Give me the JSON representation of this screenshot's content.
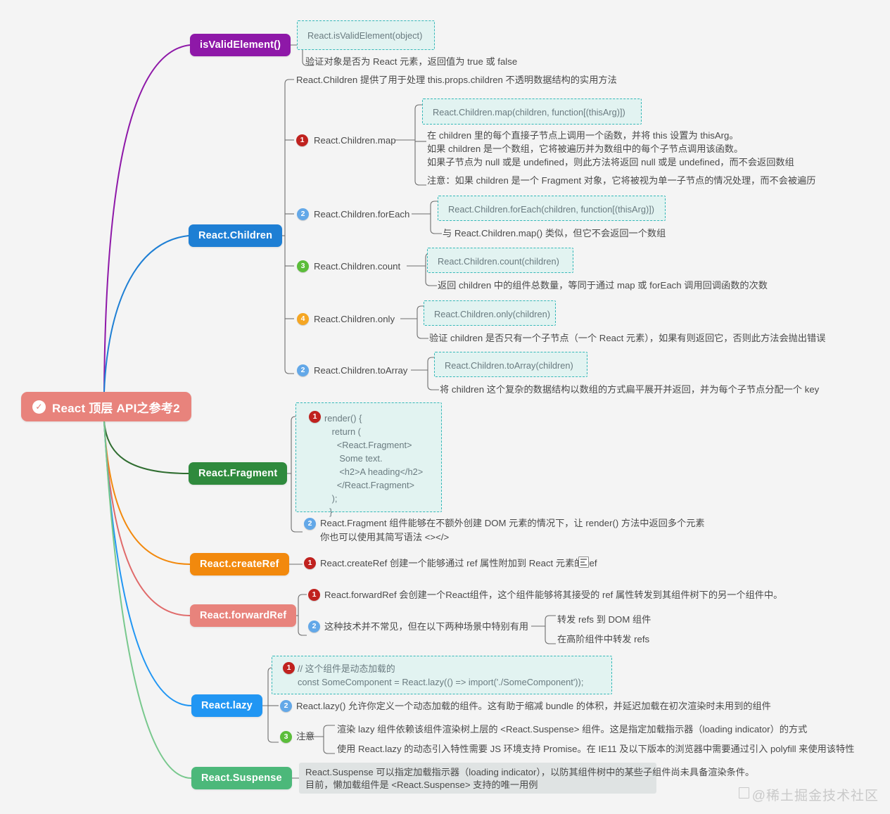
{
  "root": {
    "label": "React 顶层 API之参考2",
    "icon": "check-circle-icon",
    "color": "#e8837c"
  },
  "branches": [
    {
      "key": "isValidElement",
      "label": "isValidElement()",
      "color": "#8e18a8"
    },
    {
      "key": "children",
      "label": "React.Children",
      "color": "#1e7fd4"
    },
    {
      "key": "fragment",
      "label": "React.Fragment",
      "color": "#2f8a3d"
    },
    {
      "key": "createRef",
      "label": "React.createRef",
      "color": "#f2890d"
    },
    {
      "key": "forwardRef",
      "label": "React.forwardRef",
      "color": "#e8837c"
    },
    {
      "key": "lazy",
      "label": "React.lazy",
      "color": "#2196f3"
    },
    {
      "key": "suspense",
      "label": "React.Suspense",
      "color": "#4cb87a"
    }
  ],
  "isValidElement": {
    "code": "React.isValidElement(object)",
    "desc": "验证对象是否为 React 元素，返回值为 true 或 false"
  },
  "children": {
    "intro": "React.Children 提供了用于处理 this.props.children 不透明数据结构的实用方法",
    "items": [
      {
        "badge": "1",
        "badge_color": "red",
        "label": "React.Children.map",
        "code": "React.Children.map(children, function[(thisArg)])",
        "lines": [
          "在 children 里的每个直接子节点上调用一个函数，并将 this 设置为 thisArg。",
          "如果 children 是一个数组，它将被遍历并为数组中的每个子节点调用该函数。",
          "如果子节点为 null 或是 undefined，则此方法将返回 null 或是 undefined，而不会返回数组"
        ],
        "note": "注意：如果 children 是一个 Fragment 对象，它将被视为单一子节点的情况处理，而不会被遍历"
      },
      {
        "badge": "2",
        "badge_color": "blue",
        "label": "React.Children.forEach",
        "code": "React.Children.forEach(children, function[(thisArg)])",
        "lines": [
          "与 React.Children.map() 类似，但它不会返回一个数组"
        ],
        "note": ""
      },
      {
        "badge": "3",
        "badge_color": "green",
        "label": "React.Children.count",
        "code": "React.Children.count(children)",
        "lines": [
          "返回 children 中的组件总数量，等同于通过 map 或 forEach 调用回调函数的次数"
        ],
        "note": ""
      },
      {
        "badge": "4",
        "badge_color": "orange",
        "label": "React.Children.only",
        "code": "React.Children.only(children)",
        "lines": [
          "验证 children 是否只有一个子节点（一个 React 元素），如果有则返回它，否则此方法会抛出错误"
        ],
        "note": ""
      },
      {
        "badge": "2",
        "badge_color": "blue",
        "label": "React.Children.toArray",
        "code": "React.Children.toArray(children)",
        "lines": [
          "将 children 这个复杂的数据结构以数组的方式扁平展开并返回，并为每个子节点分配一个 key"
        ],
        "note": ""
      }
    ]
  },
  "fragment": {
    "badge1": "1",
    "code": "render() {\n   return (\n     <React.Fragment>\n      Some text.\n      <h2>A heading</h2>\n     </React.Fragment>\n   );\n  }",
    "badge2": "2",
    "desc_line1": "React.Fragment 组件能够在不额外创建 DOM 元素的情况下，让 render() 方法中返回多个元素",
    "desc_line2": "你也可以使用其简写语法 <></>"
  },
  "createRef": {
    "badge": "1",
    "desc": "React.createRef 创建一个能够通过 ref 属性附加到 React 元素的 ref",
    "icon": "document-icon"
  },
  "forwardRef": {
    "badge1": "1",
    "desc1": "React.forwardRef 会创建一个React组件，这个组件能够将其接受的 ref 属性转发到其组件树下的另一个组件中。",
    "badge2": "2",
    "desc2": "这种技术并不常见，但在以下两种场景中特别有用",
    "sub": [
      "转发 refs 到 DOM 组件",
      "在高阶组件中转发 refs"
    ]
  },
  "lazy": {
    "badge1": "1",
    "code": "// 这个组件是动态加载的\nconst SomeComponent = React.lazy(() => import('./SomeComponent'));",
    "badge2": "2",
    "desc2": "React.lazy() 允许你定义一个动态加载的组件。这有助于缩减 bundle 的体积，并延迟加载在初次渲染时未用到的组件",
    "badge3": "3",
    "note_label": "注意",
    "notes": [
      "渲染 lazy 组件依赖该组件渲染树上层的 <React.Suspense> 组件。这是指定加载指示器（loading indicator）的方式",
      "使用 React.lazy 的动态引入特性需要 JS 环境支持 Promise。在 IE11 及以下版本的浏览器中需要通过引入 polyfill 来使用该特性"
    ]
  },
  "suspense": {
    "line1": "React.Suspense 可以指定加载指示器（loading indicator），以防其组件树中的某些子组件尚未具备渲染条件。",
    "line2": "目前，懒加载组件是 <React.Suspense> 支持的唯一用例"
  },
  "watermark": {
    "text": "@稀土掘金技术社区",
    "icon": "document-icon"
  }
}
